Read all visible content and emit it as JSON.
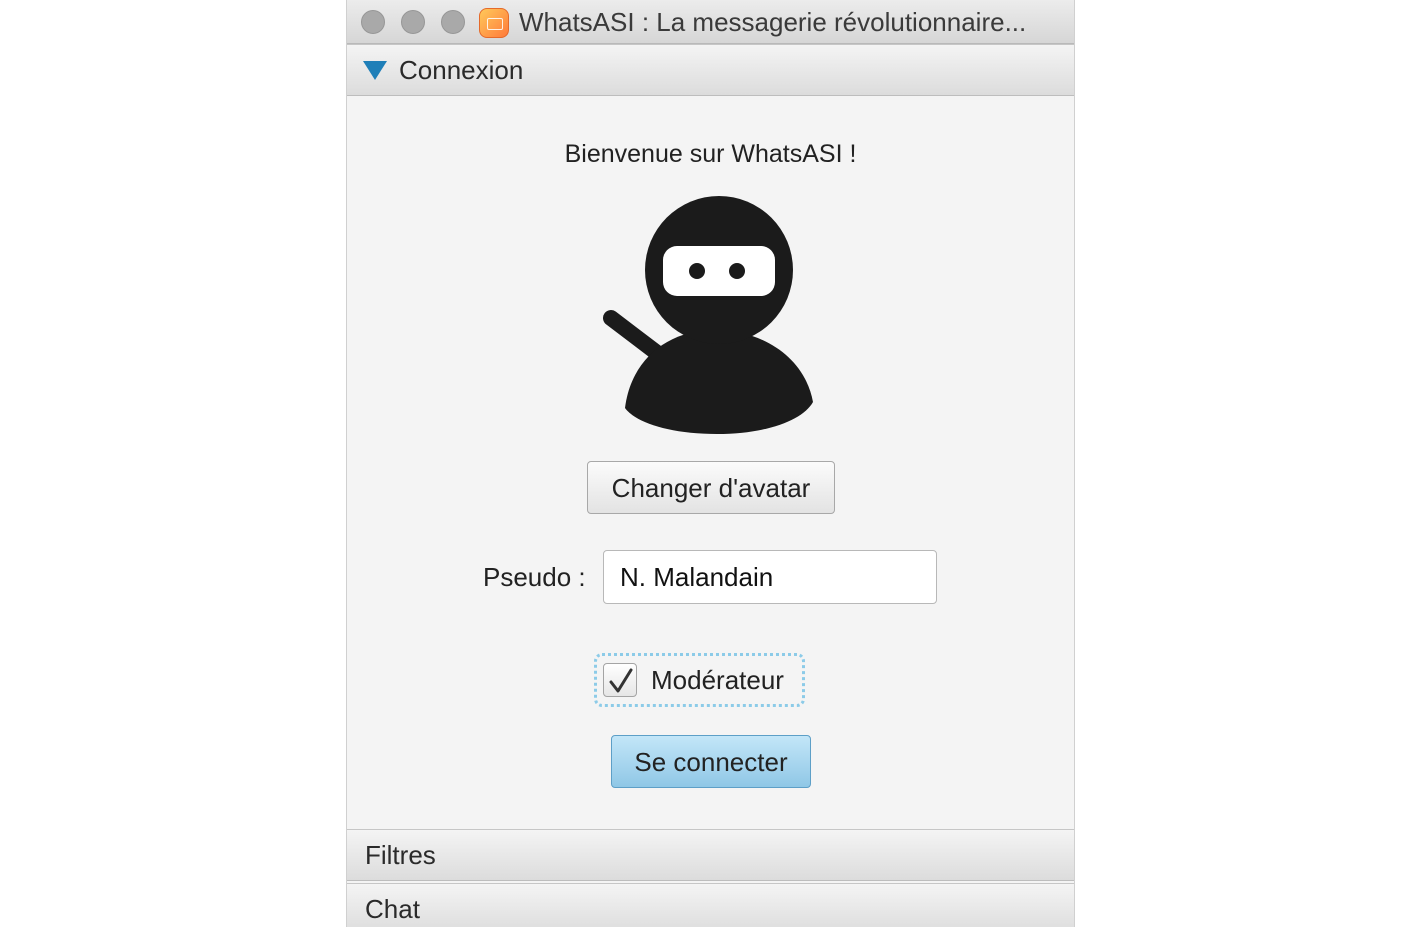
{
  "window": {
    "title": "WhatsASI : La messagerie révolutionnaire...",
    "app_icon": "whatsasi-app-icon"
  },
  "panes": {
    "connexion": {
      "label": "Connexion",
      "expanded": true
    },
    "filtres": {
      "label": "Filtres",
      "expanded": false
    },
    "chat": {
      "label": "Chat",
      "expanded": false
    }
  },
  "login": {
    "welcome": "Bienvenue sur WhatsASI !",
    "avatar_icon": "ninja-avatar-icon",
    "change_avatar_label": "Changer d'avatar",
    "pseudo_label": "Pseudo :",
    "pseudo_value": "N. Malandain",
    "moderator_label": "Modérateur",
    "moderator_checked": true,
    "connect_label": "Se connecter"
  },
  "colors": {
    "accent": "#1f7fb8",
    "connect_button": "#a6d6ee",
    "focus_ring": "#8ccbe8"
  }
}
